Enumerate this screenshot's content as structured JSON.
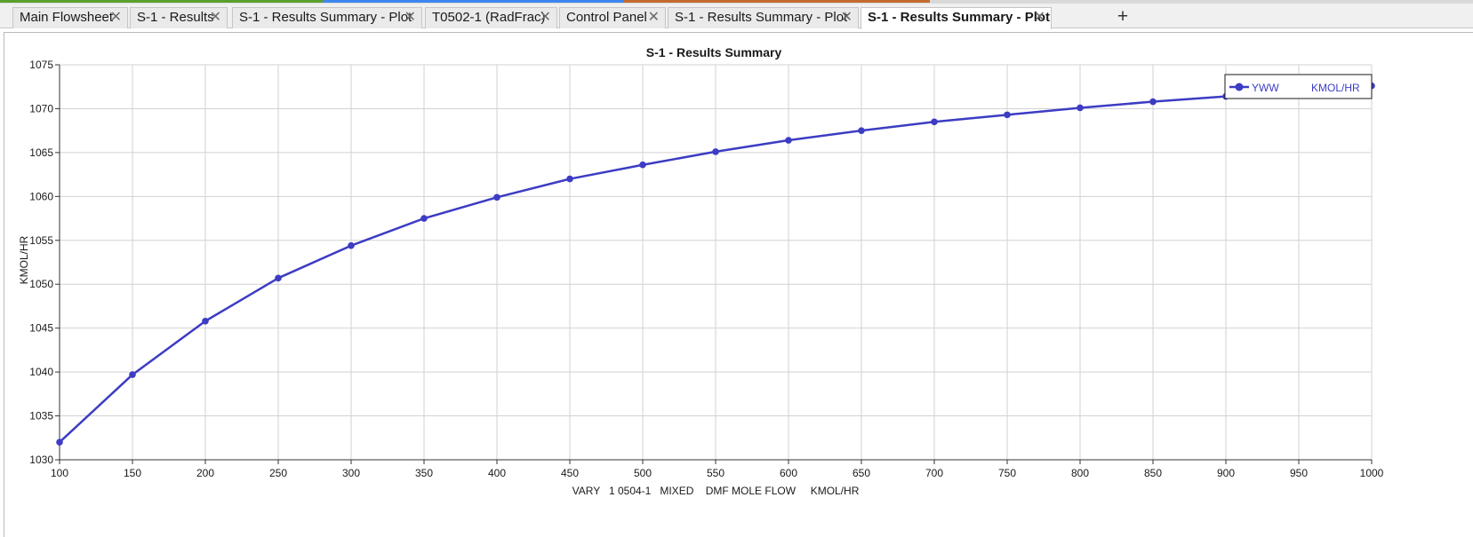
{
  "tabs": [
    {
      "label": "Main Flowsheet",
      "active": false
    },
    {
      "label": "S-1 - Results",
      "active": false
    },
    {
      "label": "S-1 - Results Summary - Plot",
      "active": false
    },
    {
      "label": "T0502-1 (RadFrac)",
      "active": false
    },
    {
      "label": "Control Panel",
      "active": false
    },
    {
      "label": "S-1 - Results Summary - Plot",
      "active": false
    },
    {
      "label": "S-1 - Results Summary - Plot",
      "active": true
    }
  ],
  "colors": {
    "series": "#3c3cc4",
    "strip_green": "#5aa02c",
    "strip_blue": "#3d86f0",
    "strip_orange": "#c46a2e"
  },
  "icons": {
    "close": "close-icon",
    "add_tab": "plus-icon"
  },
  "chart_data": {
    "type": "line",
    "title": "S-1 - Results Summary",
    "xlabel": "VARY   1 0504-1   MIXED    DMF MOLE FLOW     KMOL/HR",
    "ylabel": "KMOL/HR",
    "xlim": [
      100,
      1000
    ],
    "ylim": [
      1030,
      1075
    ],
    "x_ticks": [
      100,
      150,
      200,
      250,
      300,
      350,
      400,
      450,
      500,
      550,
      600,
      650,
      700,
      750,
      800,
      850,
      900,
      950,
      1000
    ],
    "y_ticks": [
      1030,
      1035,
      1040,
      1045,
      1050,
      1055,
      1060,
      1065,
      1070,
      1075
    ],
    "grid": true,
    "legend_position": "top-right",
    "series": [
      {
        "name": "YWW",
        "unit": "KMOL/HR",
        "x": [
          100,
          150,
          200,
          250,
          300,
          350,
          400,
          450,
          500,
          550,
          600,
          650,
          700,
          750,
          800,
          850,
          900,
          950,
          1000
        ],
        "y": [
          1032.0,
          1039.7,
          1045.8,
          1050.7,
          1054.4,
          1057.5,
          1059.9,
          1062.0,
          1063.6,
          1065.1,
          1066.4,
          1067.5,
          1068.5,
          1069.3,
          1070.1,
          1070.8,
          1071.4,
          1072.0,
          1072.6
        ]
      }
    ]
  }
}
